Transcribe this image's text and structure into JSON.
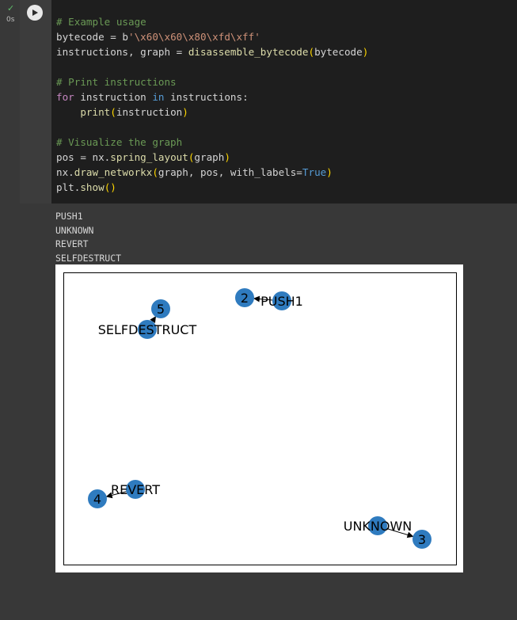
{
  "cell": {
    "status_icon": "check-icon",
    "exec_time": "0s",
    "run_icon": "play-icon"
  },
  "code": {
    "lines": [
      [
        {
          "t": "# Example usage",
          "c": "c-comment"
        }
      ],
      [
        {
          "t": "bytecode = b",
          "c": ""
        },
        {
          "t": "'\\x60\\x60\\x80\\xfd\\xff'",
          "c": "c-str"
        }
      ],
      [
        {
          "t": "instructions, graph = ",
          "c": ""
        },
        {
          "t": "disassemble_bytecode",
          "c": "c-fn"
        },
        {
          "t": "(",
          "c": "c-paren"
        },
        {
          "t": "bytecode",
          "c": ""
        },
        {
          "t": ")",
          "c": "c-paren"
        }
      ],
      [
        {
          "t": "",
          "c": ""
        }
      ],
      [
        {
          "t": "# Print instructions",
          "c": "c-comment"
        }
      ],
      [
        {
          "t": "for",
          "c": "c-kw"
        },
        {
          "t": " instruction ",
          "c": ""
        },
        {
          "t": "in",
          "c": "c-in"
        },
        {
          "t": " instructions:",
          "c": ""
        }
      ],
      [
        {
          "t": "    ",
          "c": ""
        },
        {
          "t": "print",
          "c": "c-fn"
        },
        {
          "t": "(",
          "c": "c-paren"
        },
        {
          "t": "instruction",
          "c": ""
        },
        {
          "t": ")",
          "c": "c-paren"
        }
      ],
      [
        {
          "t": "",
          "c": ""
        }
      ],
      [
        {
          "t": "# Visualize the graph",
          "c": "c-comment"
        }
      ],
      [
        {
          "t": "pos = nx.",
          "c": ""
        },
        {
          "t": "spring_layout",
          "c": "c-fn"
        },
        {
          "t": "(",
          "c": "c-paren"
        },
        {
          "t": "graph",
          "c": ""
        },
        {
          "t": ")",
          "c": "c-paren"
        }
      ],
      [
        {
          "t": "nx.",
          "c": ""
        },
        {
          "t": "draw_networkx",
          "c": "c-fn"
        },
        {
          "t": "(",
          "c": "c-paren"
        },
        {
          "t": "graph, pos, with_labels=",
          "c": ""
        },
        {
          "t": "True",
          "c": "c-const"
        },
        {
          "t": ")",
          "c": "c-paren"
        }
      ],
      [
        {
          "t": "plt.",
          "c": ""
        },
        {
          "t": "show",
          "c": "c-fn"
        },
        {
          "t": "()",
          "c": "c-paren"
        }
      ]
    ]
  },
  "output": {
    "lines": [
      "PUSH1",
      "UNKNOWN",
      "REVERT",
      "SELFDESTRUCT"
    ]
  },
  "graph": {
    "node_color": "#2f7bbf",
    "nodes": [
      {
        "label": "PUSH1"
      },
      {
        "label": "2"
      },
      {
        "label": "UNKNOWN"
      },
      {
        "label": "3"
      },
      {
        "label": "REVERT"
      },
      {
        "label": "4"
      },
      {
        "label": "SELFDESTRUCT"
      },
      {
        "label": "5"
      }
    ],
    "edges": [
      {
        "from": "PUSH1",
        "to": "2"
      },
      {
        "from": "UNKNOWN",
        "to": "3"
      },
      {
        "from": "REVERT",
        "to": "4"
      },
      {
        "from": "SELFDESTRUCT",
        "to": "5"
      }
    ]
  }
}
